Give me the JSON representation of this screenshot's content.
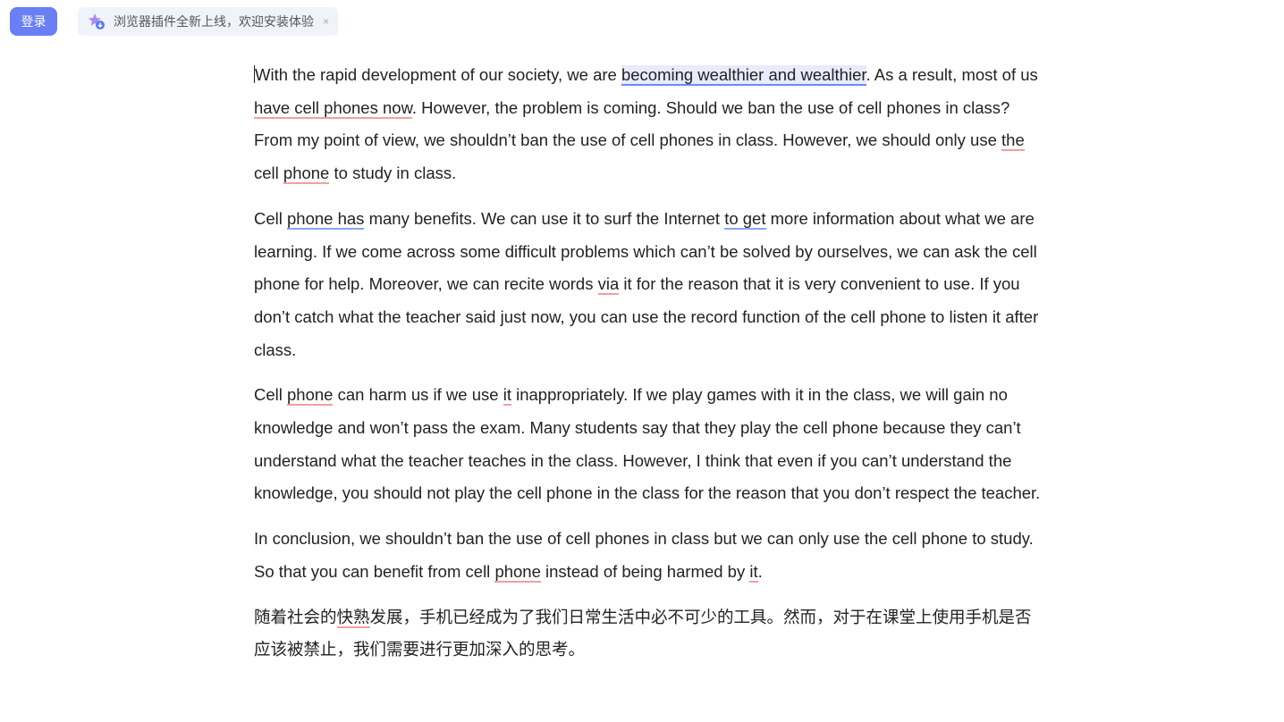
{
  "header": {
    "login_label": "登录",
    "banner_text": "浏览器插件全新上线，欢迎安装体验",
    "banner_close": "×"
  },
  "colors": {
    "accent": "#6a7ff5",
    "highlight_bg": "#e8ebfb",
    "underline_blue": "#8aa4f2",
    "underline_red": "#f0a0a0"
  },
  "icons": [
    "plugin-star-icon",
    "close-icon"
  ],
  "essay": {
    "p1": [
      {
        "t": "With the rapid development of our society, we are ",
        "s": ""
      },
      {
        "t": "becoming wealthier and wealthier",
        "s": "hl"
      },
      {
        "t": ". As a result, most of us ",
        "s": ""
      },
      {
        "t": "have cell phones now",
        "s": "ur"
      },
      {
        "t": ". However, the problem is coming. Should we ban the use of cell phones in class? From my point of view, we shouldn’t ban the use of cell phones in class. However, we should only use ",
        "s": ""
      },
      {
        "t": "the",
        "s": "ur"
      },
      {
        "t": " cell ",
        "s": ""
      },
      {
        "t": "phone",
        "s": "ur"
      },
      {
        "t": " to study in class.",
        "s": ""
      }
    ],
    "p2": [
      {
        "t": "Cell ",
        "s": ""
      },
      {
        "t": "phone has",
        "s": "ub"
      },
      {
        "t": " many benefits. We can use it to surf the Internet ",
        "s": ""
      },
      {
        "t": "to get",
        "s": "ub"
      },
      {
        "t": " more information about what we are learning. If we come across some difficult problems which can’t be solved by ourselves, we can ask the cell phone for help. Moreover, we can recite words ",
        "s": ""
      },
      {
        "t": "via",
        "s": "ur"
      },
      {
        "t": " it for the reason that it is very convenient to use. If you don’t catch what the teacher said just now, you can use the record function of the cell phone to listen it after class.",
        "s": ""
      }
    ],
    "p3": [
      {
        "t": "Cell ",
        "s": ""
      },
      {
        "t": "phone",
        "s": "ur"
      },
      {
        "t": " can harm us if we use ",
        "s": ""
      },
      {
        "t": "it",
        "s": "ur"
      },
      {
        "t": " inappropriately. If we play games with it in the class, we will gain no knowledge and won’t pass the exam. Many students say that they play the cell phone because they can’t understand what the teacher teaches in the class. However, I think that even if you can’t understand the knowledge, you should not play the cell phone in the class for the reason that you don’t respect the teacher.",
        "s": ""
      }
    ],
    "p4": [
      {
        "t": "In conclusion, we shouldn’t ban the use of cell phones in class but we can only use the cell phone to study. So that you can benefit from cell ",
        "s": ""
      },
      {
        "t": "phone",
        "s": "ur"
      },
      {
        "t": " instead of being harmed by ",
        "s": ""
      },
      {
        "t": "it",
        "s": "ur"
      },
      {
        "t": ".",
        "s": ""
      }
    ],
    "p5": [
      {
        "t": "随着社会的",
        "s": ""
      },
      {
        "t": "快熟",
        "s": "ur"
      },
      {
        "t": "发展，手机已经成为了我们日常生活中必不可少的工具。然而，对于在课堂上使用手机是否应该被禁止，我们需要进行更加深入的思考。",
        "s": ""
      }
    ]
  }
}
